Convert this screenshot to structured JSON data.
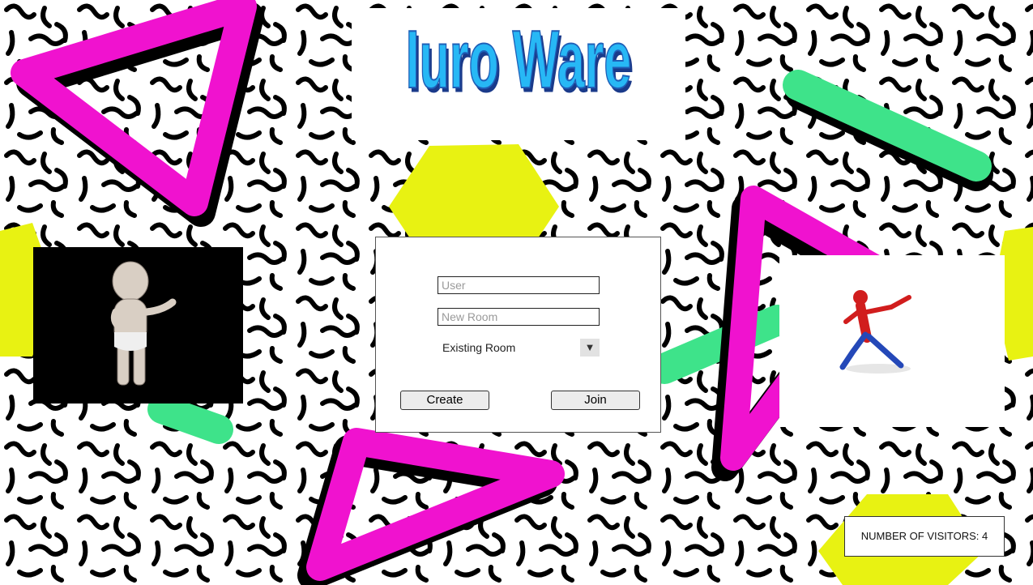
{
  "logo": {
    "text": "Iuro Ware"
  },
  "form": {
    "user_placeholder": "User",
    "new_room_placeholder": "New Room",
    "existing_room_selected": "Existing Room",
    "create_label": "Create",
    "join_label": "Join"
  },
  "visitors": {
    "label": "NUMBER OF VISITORS: 4"
  },
  "colors": {
    "magenta": "#f012cf",
    "yellow": "#e8f212",
    "green": "#3ee38a",
    "logo_blue": "#27b8f5"
  }
}
